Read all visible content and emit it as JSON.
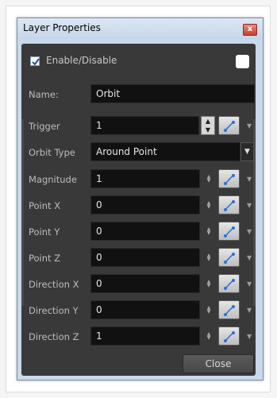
{
  "window": {
    "title": "Layer Properties",
    "close_symbol": "x"
  },
  "enable": {
    "label": "Enable/Disable",
    "checked": true
  },
  "name": {
    "label": "Name:",
    "value": "Orbit"
  },
  "trigger": {
    "label": "Trigger",
    "value": "1"
  },
  "orbit_type": {
    "label": "Orbit Type",
    "value": "Around Point"
  },
  "params": [
    {
      "label": "Magnitude",
      "value": "1"
    },
    {
      "label": "Point X",
      "value": "0"
    },
    {
      "label": "Point Y",
      "value": "0"
    },
    {
      "label": "Point Z",
      "value": "0"
    },
    {
      "label": "Direction X",
      "value": "0"
    },
    {
      "label": "Direction Y",
      "value": "0"
    },
    {
      "label": "Direction Z",
      "value": "1"
    }
  ],
  "close_button": {
    "label": "Close"
  },
  "colors": {
    "panel": "#393939",
    "field": "#111111",
    "accent": "#2f6fd6"
  }
}
